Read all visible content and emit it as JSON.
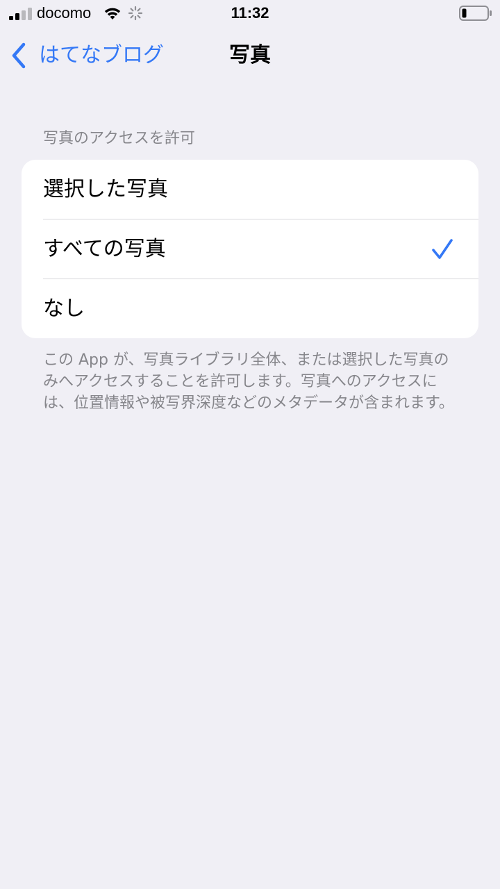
{
  "status_bar": {
    "carrier": "docomo",
    "time": "11:32"
  },
  "nav": {
    "back_label": "はてなブログ",
    "title": "写真"
  },
  "section": {
    "header": "写真のアクセスを許可",
    "options": [
      {
        "label": "選択した写真",
        "selected": false
      },
      {
        "label": "すべての写真",
        "selected": true
      },
      {
        "label": "なし",
        "selected": false
      }
    ],
    "footer": "この App が、写真ライブラリ全体、または選択した写真のみへアクセスすることを許可します。写真へのアクセスには、位置情報や被写界深度などのメタデータが含まれます。"
  },
  "colors": {
    "accent": "#3478f6",
    "background": "#f0eff5",
    "secondary_text": "#86868b"
  }
}
